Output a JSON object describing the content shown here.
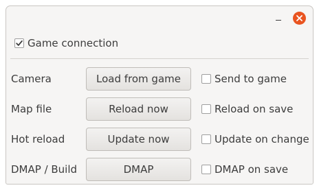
{
  "titlebar": {
    "minimize_icon": "minimize-icon",
    "close_icon": "close-icon",
    "close_color": "#e95420"
  },
  "connection": {
    "label": "Game connection",
    "checked": true
  },
  "rows": [
    {
      "label": "Camera",
      "button": "Load from game",
      "option": "Send to game",
      "checked": false
    },
    {
      "label": "Map file",
      "button": "Reload now",
      "option": "Reload on save",
      "checked": false
    },
    {
      "label": "Hot reload",
      "button": "Update now",
      "option": "Update on change",
      "checked": false
    },
    {
      "label": "DMAP / Build",
      "button": "DMAP",
      "option": "DMAP on save",
      "checked": false
    }
  ]
}
